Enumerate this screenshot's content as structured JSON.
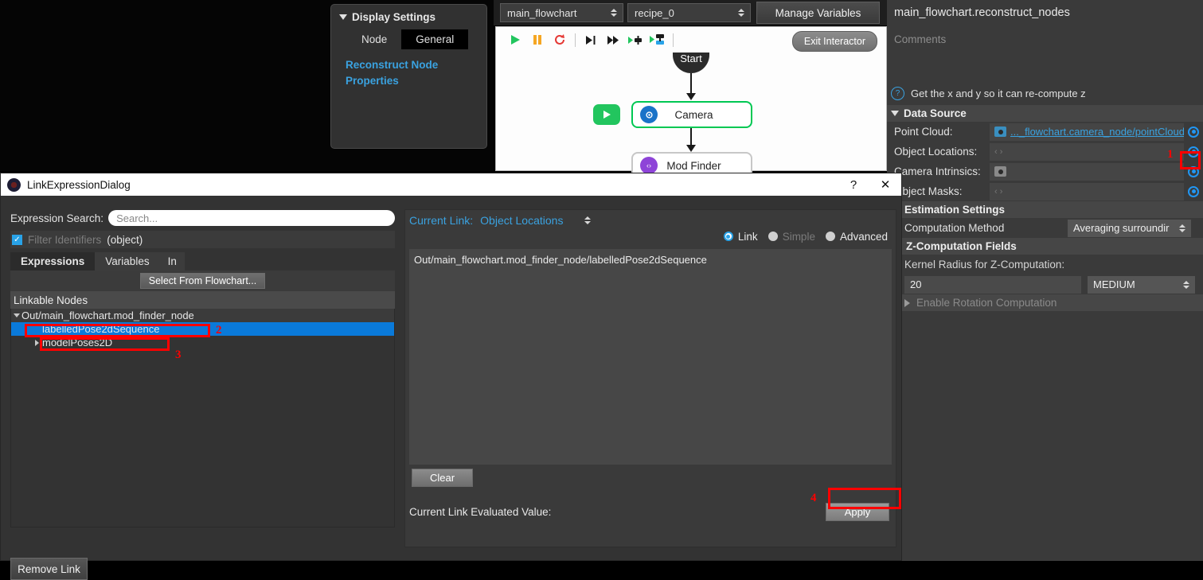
{
  "app": {
    "background_color": "#000000",
    "panel_color": "#3a3a3a",
    "accent_color": "#3aa2e0",
    "selection_color": "#0a7ada",
    "annotation_color": "#ff0000"
  },
  "display_settings": {
    "title": "Display Settings",
    "tabs": [
      {
        "label": "Node",
        "active": false
      },
      {
        "label": "General",
        "active": true
      }
    ],
    "link_label": "Reconstruct Node Properties"
  },
  "topbar": {
    "flowchart_combo": "main_flowchart",
    "recipe_combo": "recipe_0",
    "manage_variables_label": "Manage Variables"
  },
  "flowchart": {
    "exit_interactor_label": "Exit Interactor",
    "toolbar": [
      {
        "icon": "play-icon",
        "color": "#22c55e"
      },
      {
        "icon": "pause-icon",
        "color": "#f5a623"
      },
      {
        "icon": "reload-icon",
        "color": "#e53935"
      },
      {
        "icon": "step-into-icon",
        "color": "#1a1a1a"
      },
      {
        "icon": "step-over-icon",
        "color": "#1a1a1a"
      },
      {
        "icon": "run-node-icon",
        "color": "#1a1a1a"
      },
      {
        "icon": "run-to-node-icon",
        "color": "#1a1a1a"
      }
    ],
    "nodes": [
      {
        "label": "Start",
        "type": "start"
      },
      {
        "label": "Camera",
        "type": "node",
        "icon": "camera-node-icon",
        "icon_color": "#1a73c8",
        "selected": true
      },
      {
        "label": "Mod Finder",
        "type": "node",
        "icon": "mod-finder-icon",
        "icon_color": "#8e44d8",
        "selected": false
      }
    ]
  },
  "properties": {
    "title": "main_flowchart.reconstruct_nodes",
    "comments_placeholder": "Comments",
    "hint": "Get the x and y so it can re-compute z",
    "data_source": {
      "header": "Data Source",
      "rows": [
        {
          "label": "Point Cloud:",
          "value": "..._flowchart.camera_node/pointCloud",
          "icon": "camera-chip-icon",
          "is_link": true
        },
        {
          "label": "Object Locations:",
          "value": "‹ ›",
          "icon": null,
          "is_link": false
        },
        {
          "label": "Camera Intrinsics:",
          "value": "",
          "icon": "camera-chip-grey-icon",
          "is_link": false
        },
        {
          "label": "Object Masks:",
          "value": "‹ ›",
          "icon": null,
          "is_link": false
        }
      ]
    },
    "estimation_settings": {
      "header": "Estimation Settings",
      "computation_method_label": "Computation Method",
      "computation_method_value": "Averaging surroundir",
      "z_fields_header": "Z-Computation Fields",
      "kernel_radius_label": "Kernel Radius for Z-Computation:",
      "kernel_radius_value": "20",
      "kernel_size_value": "MEDIUM",
      "enable_rotation_label": "Enable Rotation Computation"
    }
  },
  "dialog": {
    "title": "LinkExpressionDialog",
    "help_button": "?",
    "close_button": "✕",
    "expression_search_label": "Expression Search:",
    "expression_search_placeholder": "Search...",
    "expression_search_value": "",
    "filter_identifiers_label": "Filter Identifiers",
    "filter_identifiers_checked": true,
    "filter_type": "(object)",
    "tabs": [
      {
        "label": "Expressions",
        "active": true
      },
      {
        "label": "Variables",
        "active": false
      },
      {
        "label": "In",
        "active": false
      }
    ],
    "select_from_flowchart_label": "Select From Flowchart...",
    "linkable_nodes_header": "Linkable Nodes",
    "tree": [
      {
        "label": "Out/main_flowchart.mod_finder_node",
        "indent": 0,
        "expander": "down",
        "selected": false
      },
      {
        "label": "labelledPose2dSequence",
        "indent": 1,
        "expander": "none",
        "selected": true
      },
      {
        "label": "modelPoses2D",
        "indent": 1,
        "expander": "right",
        "selected": false
      }
    ],
    "remove_link_label": "Remove Link",
    "current_link_label": "Current Link:",
    "current_link_value": "Object Locations",
    "modes": [
      {
        "label": "Link",
        "selected": true,
        "disabled": false
      },
      {
        "label": "Simple",
        "selected": false,
        "disabled": true
      },
      {
        "label": "Advanced",
        "selected": false,
        "disabled": false
      }
    ],
    "expression_text": "Out/main_flowchart.mod_finder_node/labelledPose2dSequence",
    "clear_label": "Clear",
    "evaluated_value_label": "Current Link Evaluated Value:",
    "evaluated_value": "",
    "apply_label": "Apply"
  },
  "annotations": [
    {
      "number": "1",
      "target": "object-locations-target-button"
    },
    {
      "number": "2",
      "target": "tree-node-mod-finder"
    },
    {
      "number": "3",
      "target": "tree-node-labelled-pose"
    },
    {
      "number": "4",
      "target": "apply-button"
    }
  ]
}
